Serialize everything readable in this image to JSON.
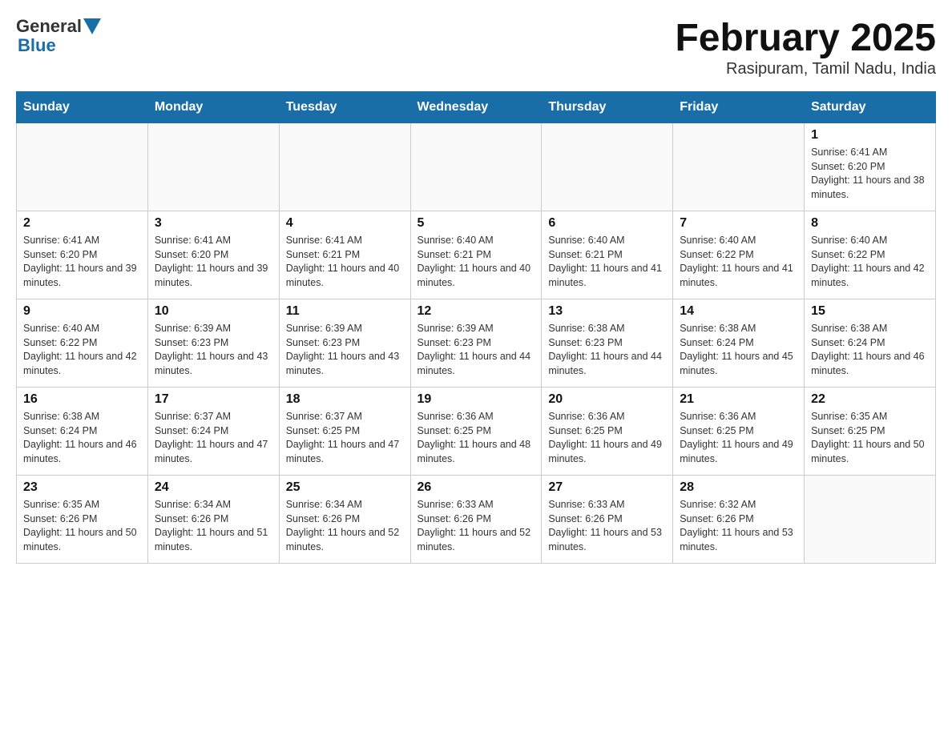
{
  "header": {
    "logo_general": "General",
    "logo_blue": "Blue",
    "title": "February 2025",
    "location": "Rasipuram, Tamil Nadu, India"
  },
  "days_of_week": [
    "Sunday",
    "Monday",
    "Tuesday",
    "Wednesday",
    "Thursday",
    "Friday",
    "Saturday"
  ],
  "weeks": [
    [
      {
        "day": "",
        "info": ""
      },
      {
        "day": "",
        "info": ""
      },
      {
        "day": "",
        "info": ""
      },
      {
        "day": "",
        "info": ""
      },
      {
        "day": "",
        "info": ""
      },
      {
        "day": "",
        "info": ""
      },
      {
        "day": "1",
        "info": "Sunrise: 6:41 AM\nSunset: 6:20 PM\nDaylight: 11 hours and 38 minutes."
      }
    ],
    [
      {
        "day": "2",
        "info": "Sunrise: 6:41 AM\nSunset: 6:20 PM\nDaylight: 11 hours and 39 minutes."
      },
      {
        "day": "3",
        "info": "Sunrise: 6:41 AM\nSunset: 6:20 PM\nDaylight: 11 hours and 39 minutes."
      },
      {
        "day": "4",
        "info": "Sunrise: 6:41 AM\nSunset: 6:21 PM\nDaylight: 11 hours and 40 minutes."
      },
      {
        "day": "5",
        "info": "Sunrise: 6:40 AM\nSunset: 6:21 PM\nDaylight: 11 hours and 40 minutes."
      },
      {
        "day": "6",
        "info": "Sunrise: 6:40 AM\nSunset: 6:21 PM\nDaylight: 11 hours and 41 minutes."
      },
      {
        "day": "7",
        "info": "Sunrise: 6:40 AM\nSunset: 6:22 PM\nDaylight: 11 hours and 41 minutes."
      },
      {
        "day": "8",
        "info": "Sunrise: 6:40 AM\nSunset: 6:22 PM\nDaylight: 11 hours and 42 minutes."
      }
    ],
    [
      {
        "day": "9",
        "info": "Sunrise: 6:40 AM\nSunset: 6:22 PM\nDaylight: 11 hours and 42 minutes."
      },
      {
        "day": "10",
        "info": "Sunrise: 6:39 AM\nSunset: 6:23 PM\nDaylight: 11 hours and 43 minutes."
      },
      {
        "day": "11",
        "info": "Sunrise: 6:39 AM\nSunset: 6:23 PM\nDaylight: 11 hours and 43 minutes."
      },
      {
        "day": "12",
        "info": "Sunrise: 6:39 AM\nSunset: 6:23 PM\nDaylight: 11 hours and 44 minutes."
      },
      {
        "day": "13",
        "info": "Sunrise: 6:38 AM\nSunset: 6:23 PM\nDaylight: 11 hours and 44 minutes."
      },
      {
        "day": "14",
        "info": "Sunrise: 6:38 AM\nSunset: 6:24 PM\nDaylight: 11 hours and 45 minutes."
      },
      {
        "day": "15",
        "info": "Sunrise: 6:38 AM\nSunset: 6:24 PM\nDaylight: 11 hours and 46 minutes."
      }
    ],
    [
      {
        "day": "16",
        "info": "Sunrise: 6:38 AM\nSunset: 6:24 PM\nDaylight: 11 hours and 46 minutes."
      },
      {
        "day": "17",
        "info": "Sunrise: 6:37 AM\nSunset: 6:24 PM\nDaylight: 11 hours and 47 minutes."
      },
      {
        "day": "18",
        "info": "Sunrise: 6:37 AM\nSunset: 6:25 PM\nDaylight: 11 hours and 47 minutes."
      },
      {
        "day": "19",
        "info": "Sunrise: 6:36 AM\nSunset: 6:25 PM\nDaylight: 11 hours and 48 minutes."
      },
      {
        "day": "20",
        "info": "Sunrise: 6:36 AM\nSunset: 6:25 PM\nDaylight: 11 hours and 49 minutes."
      },
      {
        "day": "21",
        "info": "Sunrise: 6:36 AM\nSunset: 6:25 PM\nDaylight: 11 hours and 49 minutes."
      },
      {
        "day": "22",
        "info": "Sunrise: 6:35 AM\nSunset: 6:25 PM\nDaylight: 11 hours and 50 minutes."
      }
    ],
    [
      {
        "day": "23",
        "info": "Sunrise: 6:35 AM\nSunset: 6:26 PM\nDaylight: 11 hours and 50 minutes."
      },
      {
        "day": "24",
        "info": "Sunrise: 6:34 AM\nSunset: 6:26 PM\nDaylight: 11 hours and 51 minutes."
      },
      {
        "day": "25",
        "info": "Sunrise: 6:34 AM\nSunset: 6:26 PM\nDaylight: 11 hours and 52 minutes."
      },
      {
        "day": "26",
        "info": "Sunrise: 6:33 AM\nSunset: 6:26 PM\nDaylight: 11 hours and 52 minutes."
      },
      {
        "day": "27",
        "info": "Sunrise: 6:33 AM\nSunset: 6:26 PM\nDaylight: 11 hours and 53 minutes."
      },
      {
        "day": "28",
        "info": "Sunrise: 6:32 AM\nSunset: 6:26 PM\nDaylight: 11 hours and 53 minutes."
      },
      {
        "day": "",
        "info": ""
      }
    ]
  ]
}
